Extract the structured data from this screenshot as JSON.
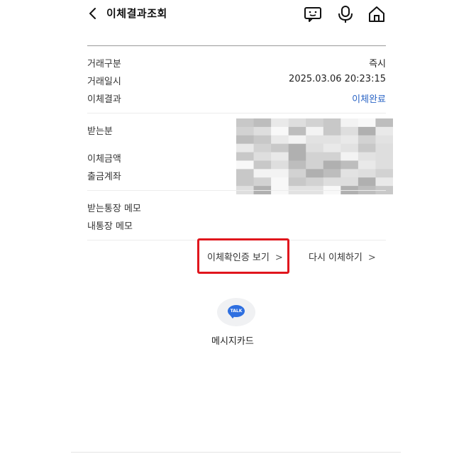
{
  "header": {
    "title": "이체결과조회"
  },
  "details": {
    "type_label": "거래구분",
    "type_value": "즉시",
    "datetime_label": "거래일시",
    "datetime_value": "2025.03.06 20:23:15",
    "result_label": "이체결과",
    "result_value": "이체완료",
    "recipient_label": "받는분",
    "amount_label": "이체금액",
    "account_label": "출금계좌",
    "recipient_memo_label": "받는통장 메모",
    "my_memo_label": "내통장 메모"
  },
  "actions": {
    "confirm_label": "이체확인증 보기",
    "retry_label": "다시 이체하기"
  },
  "share": {
    "badge": "TALK",
    "label": "메시지카드"
  },
  "colors": {
    "accent_blue": "#2a64c5",
    "highlight_red": "#e0161d",
    "kakao_blue": "#2e6fe0"
  }
}
